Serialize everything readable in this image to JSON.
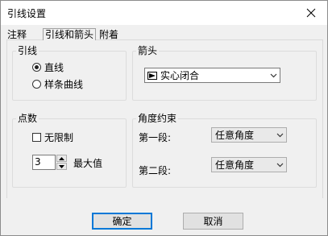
{
  "window": {
    "title": "引线设置"
  },
  "tabs": [
    {
      "label": "注释",
      "active": false
    },
    {
      "label": "引线和箭头",
      "active": true
    },
    {
      "label": "附着",
      "active": false
    }
  ],
  "leader": {
    "title": "引线",
    "options": [
      {
        "label": "直线",
        "checked": true
      },
      {
        "label": "样条曲线",
        "checked": false
      }
    ]
  },
  "arrowhead": {
    "title": "箭头",
    "selected": "实心闭合",
    "icon": "filled-closed-arrow-icon"
  },
  "points": {
    "title": "点数",
    "unlimited_label": "无限制",
    "unlimited_checked": false,
    "max_value": "3",
    "max_label": "最大值"
  },
  "angle": {
    "title": "角度约束",
    "first_label": "第一段:",
    "first_value": "任意角度",
    "second_label": "第二段:",
    "second_value": "任意角度"
  },
  "buttons": {
    "ok": "确定",
    "cancel": "取消"
  }
}
